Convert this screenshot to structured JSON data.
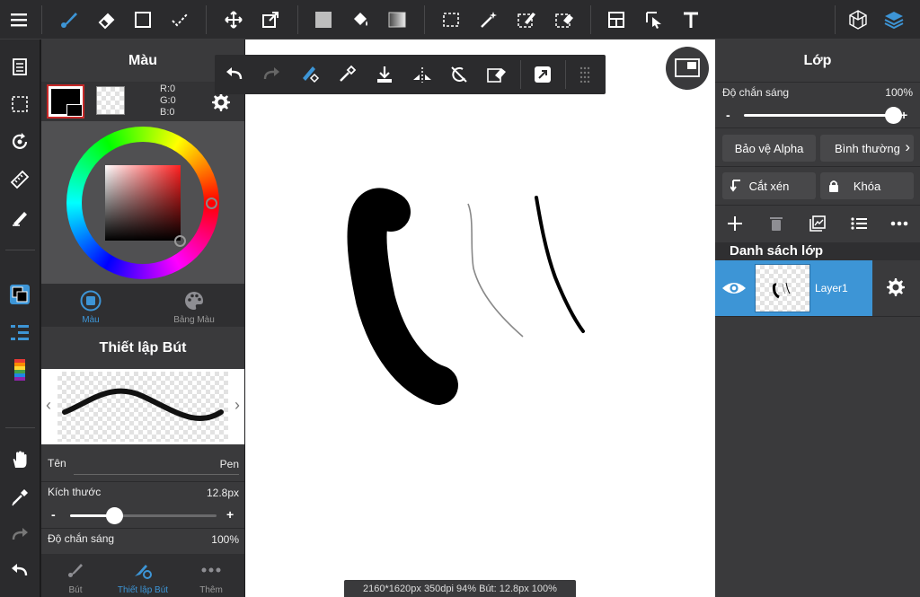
{
  "color_panel": {
    "title": "Màu",
    "rgb": {
      "r": "R:0",
      "g": "G:0",
      "b": "B:0"
    },
    "tabs": [
      "Màu",
      "Bảng Màu"
    ]
  },
  "brush_settings": {
    "title": "Thiết lập Bút",
    "name_label": "Tên",
    "name_value": "Pen",
    "size_label": "Kích thước",
    "size_value": "12.8px",
    "size_level": 0.3,
    "opacity_label": "Độ chắn sáng",
    "opacity_value": "100%",
    "minus": "-",
    "plus": "+"
  },
  "bottom_tabs": [
    "Bút",
    "Thiết lập Bút",
    "Thêm"
  ],
  "layer_panel": {
    "title": "Lớp",
    "opacity_label": "Độ chắn sáng",
    "opacity_value": "100%",
    "opacity_level": 1.0,
    "minus": "-",
    "plus": "+",
    "protect_alpha": "Bảo vệ Alpha",
    "blend_mode": "Bình thường",
    "clipping": "Cắt xén",
    "lock": "Khóa",
    "list_title": "Danh sách lớp",
    "layers": [
      {
        "name": "Layer1",
        "visible": true,
        "selected": true
      }
    ]
  },
  "status_bar": {
    "text": "2160*1620px 350dpi 94% Bút: 12.8px 100%"
  },
  "colors": {
    "accent": "#3d95d6",
    "panel": "#3a3a3c",
    "toolbar": "#2b2b2d",
    "primary_color": "#000000"
  }
}
